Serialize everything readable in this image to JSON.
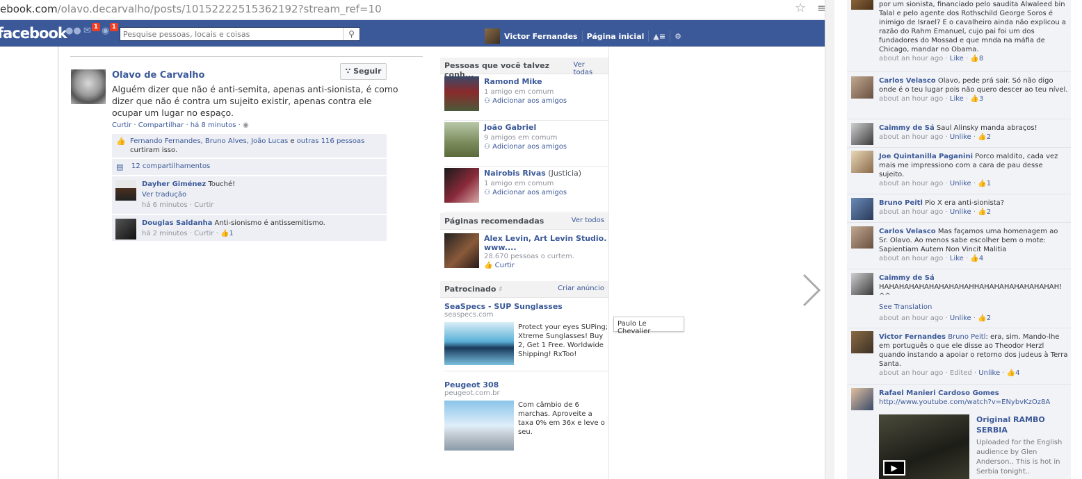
{
  "browser": {
    "url_host": "ebook.com",
    "url_path": "/olavo.decarvalho/posts/10152222515362192?stream_ref=10"
  },
  "topbar": {
    "logo": "facebook",
    "badge_messages": "1",
    "badge_notifications": "1",
    "search_placeholder": "Pesquise pessoas, locais e coisas",
    "user_name": "Victor Fernandes",
    "home_label": "Página inicial"
  },
  "post": {
    "author": "Olavo de Carvalho",
    "follow_label": "Seguir",
    "text": "Alguém dizer que não é anti-semita, apenas anti-sionista, é como dizer que não é contra um sujeito existir, apenas contra ele ocupar um lugar no espaço.",
    "actions": "Curtir · Compartilhar · há 8 minutos ·",
    "likes_names": "Fernando Fernandes, Bruno Alves, João Lucas",
    "likes_and": " e ",
    "likes_others": "outras 116 pessoas",
    "likes_suffix": "curtiram isso.",
    "shares": "12 compartilhamentos",
    "comments": [
      {
        "author": "Dayher Giménez",
        "text": " Touché!",
        "translate": "Ver tradução",
        "meta": "há 6 minutos · Curtir"
      },
      {
        "author": "Douglas Saldanha",
        "text": " Anti-sionismo é antissemitismo.",
        "meta": "há 2 minutos · Curtir · ",
        "like_count": "1"
      }
    ]
  },
  "pymk": {
    "title": "Pessoas que você talvez conh...",
    "see_all": "Ver todas",
    "add_label": "Adicionar aos amigos",
    "people": [
      {
        "name": "Ramond Mike",
        "extra": "",
        "mutual": "1 amigo em comum"
      },
      {
        "name": "João Gabriel",
        "extra": "",
        "mutual": "9 amigos em comum"
      },
      {
        "name": "Nairobis Rivas",
        "extra": " (Justicia)",
        "mutual": "1 amigo em comum"
      }
    ]
  },
  "pages": {
    "title": "Páginas recomendadas",
    "see_all": "Ver todos",
    "name": "Alex Levin, Art Levin Studio. www....",
    "likes": "28.670 pessoas o curtem.",
    "like_label": "Curtir"
  },
  "sponsored": {
    "title": "Patrocinado",
    "create": "Criar anúncio",
    "ads": [
      {
        "title": "SeaSpecs - SUP Sunglasses",
        "url": "seaspecs.com",
        "body": "Protect your eyes SUPing; Xtreme Sunglasses! Buy 2, Get 1 Free. Worldwide Shipping! RxToo!"
      },
      {
        "title": "Peugeot 308",
        "url": "peugeot.com.br",
        "body": "Com câmbio de 6 marchas. Aproveite a taxa 0% em 36x e leve o seu."
      }
    ]
  },
  "tooltip": "Paulo Le Chevalier",
  "ticker": [
    {
      "name": "",
      "text": "por um sionista, financiado pelo saudita Alwaleed bin Talal e pelo agente dos Rothschild George Soros é inimigo de Israel? E o cavalheiro ainda não explicou a razão do Rahm Emanuel, cujo pai foi um dos fundadores do Mossad e que mnda na máfia de Chicago, mandar no Obama.",
      "time": "about an hour ago · ",
      "action": "Like",
      "count": "8"
    },
    {
      "name": "Carlos Velasco",
      "text": " Olavo, pede prá sair. Só não digo onde é o teu lugar pois não quero descer ao teu nível.",
      "time": "about an hour ago · ",
      "action": "Like",
      "count": "3"
    },
    {
      "name": "Caimmy de Sá",
      "text": " Saul Alinsky manda abraços!",
      "time": "about an hour ago · ",
      "action": "Unlike",
      "count": "2"
    },
    {
      "name": "Joe Quintanilla Paganini",
      "text": " Porco maldito, cada vez mais me impressiono com a cara de pau desse sujeito.",
      "time": "about an hour ago · ",
      "action": "Unlike",
      "count": "1"
    },
    {
      "name": "Bruno Peitl",
      "text": " Pio X era anti-sionista?",
      "time": "about an hour ago · ",
      "action": "Unlike",
      "count": "2"
    },
    {
      "name": "Carlos Velasco",
      "text": " Mas façamos uma homenagem ao Sr. Olavo. Ao menos sabe escolher bem o mote: Sapientiam Autem Non Vincit Malitia",
      "time": "about an hour ago · ",
      "action": "Like",
      "count": "4"
    },
    {
      "name": "Caimmy de Sá",
      "text": " HAHAHAHAHAHAHAHAHAHHAHAHAHAHAHAHAHAH! ^^",
      "translate": "See Translation",
      "time": "about an hour ago · ",
      "action": "Unlike",
      "count": "2"
    },
    {
      "name": "Victor Fernandes",
      "mention": " Bruno Peitl",
      "text": ": era, sim. Mando-lhe em português o que ele disse ao Theodor Herzl quando instando a apoiar o retorno dos judeus à Terra Santa.",
      "time": "about an hour ago · Edited · ",
      "action": "Unlike",
      "count": "4"
    },
    {
      "name": "Rafael Manieri Cardoso Gomes",
      "link": "http://www.youtube.com/watch?v=ENybvKzOz8A",
      "video_title": "Original RAMBO SERBIA",
      "video_desc": "Uploaded for the English audience by Glen Anderson.. This is hot in Serbia tonight.."
    }
  ]
}
